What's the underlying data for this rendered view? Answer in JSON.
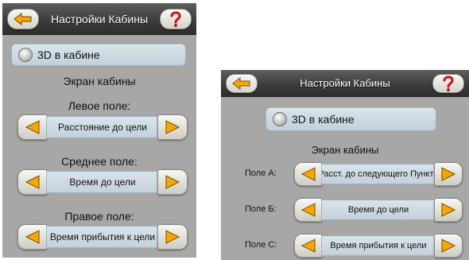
{
  "left_screen": {
    "title": "Настройки Кабины",
    "toggle_label": "3D в кабине",
    "section_title": "Экран кабины",
    "fields": [
      {
        "label": "Левое поле:",
        "value": "Расстояние до цели"
      },
      {
        "label": "Среднее поле:",
        "value": "Время до цели"
      },
      {
        "label": "Правое поле:",
        "value": "Время прибытия к цели"
      }
    ]
  },
  "right_screen": {
    "title": "Настройки Кабины",
    "toggle_label": "3D в кабине",
    "section_title": "Экран кабины",
    "fields": [
      {
        "label": "Поле А:",
        "value": "Расст. до следующего Пункта"
      },
      {
        "label": "Поле Б:",
        "value": "Время до цели"
      },
      {
        "label": "Поле С:",
        "value": "Время прибытия к цели"
      }
    ]
  },
  "icons": {
    "back": "back-arrow-icon",
    "help": "question-mark-icon",
    "prev": "left-triangle-icon",
    "next": "right-triangle-icon",
    "toggle": "radio-toggle-icon"
  },
  "colors": {
    "panel_background": "#a7a7a7",
    "title_bar": "#3d3d3d",
    "value_box": "#cfdae2",
    "arrow_fill": "#f5a800",
    "help_mark": "#c8101c"
  }
}
